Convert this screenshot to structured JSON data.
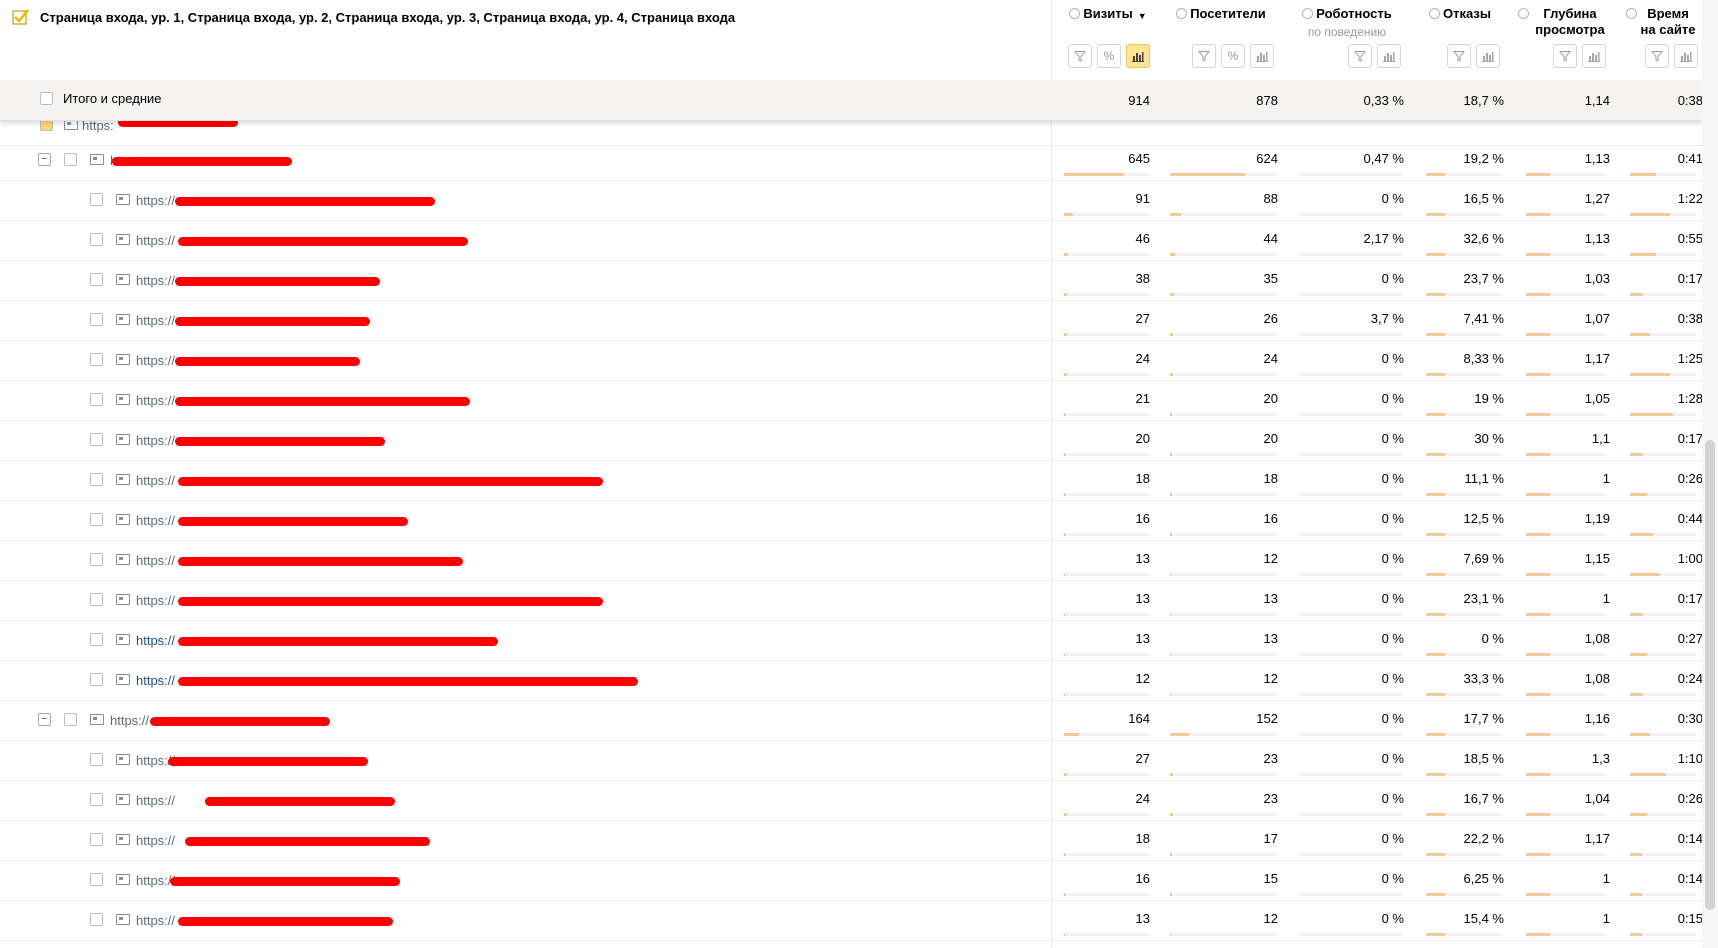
{
  "header": {
    "dimensions_title": "Страница входа, ур. 1, Страница входа, ур. 2, Страница входа, ур. 3, Страница входа, ур. 4, Страница входа",
    "columns": [
      {
        "title": "Визиты",
        "sub": "",
        "sorted": true,
        "sort_arrow": "▼"
      },
      {
        "title": "Посетители",
        "sub": ""
      },
      {
        "title": "Роботность",
        "sub": "по поведению"
      },
      {
        "title": "Отказы",
        "sub": ""
      },
      {
        "title": "Глубина просмотра",
        "sub": ""
      },
      {
        "title": "Время на сайте",
        "sub": ""
      }
    ]
  },
  "totals": {
    "label": "Итого и средние",
    "values": [
      "914",
      "878",
      "0,33 %",
      "18,7 %",
      "1,14",
      "0:38"
    ]
  },
  "partial_row": {
    "url": "https:"
  },
  "rows": [
    {
      "level": 1,
      "url": "ht",
      "toggle": "−",
      "link": false,
      "values": [
        "645",
        "624",
        "0,47 %",
        "19,2 %",
        "1,13",
        "0:41"
      ],
      "bars": [
        0.71,
        0.71,
        0.0,
        0.25,
        0.3,
        0.4
      ]
    },
    {
      "level": 2,
      "url": "https://",
      "link": false,
      "values": [
        "91",
        "88",
        "0 %",
        "16,5 %",
        "1,27",
        "1:22"
      ],
      "bars": [
        0.1,
        0.1,
        0.0,
        0.25,
        0.3,
        0.6
      ]
    },
    {
      "level": 2,
      "url": "https://",
      "link": false,
      "values": [
        "46",
        "44",
        "2,17 %",
        "32,6 %",
        "1,13",
        "0:55"
      ],
      "bars": [
        0.05,
        0.05,
        0.0,
        0.25,
        0.3,
        0.4
      ]
    },
    {
      "level": 2,
      "url": "https://",
      "link": false,
      "values": [
        "38",
        "35",
        "0 %",
        "23,7 %",
        "1,03",
        "0:17"
      ],
      "bars": [
        0.04,
        0.04,
        0.0,
        0.25,
        0.3,
        0.2
      ]
    },
    {
      "level": 2,
      "url": "https://",
      "link": false,
      "values": [
        "27",
        "26",
        "3,7 %",
        "7,41 %",
        "1,07",
        "0:38"
      ],
      "bars": [
        0.03,
        0.03,
        0.0,
        0.25,
        0.3,
        0.3
      ]
    },
    {
      "level": 2,
      "url": "https://",
      "link": false,
      "values": [
        "24",
        "24",
        "0 %",
        "8,33 %",
        "1,17",
        "1:25"
      ],
      "bars": [
        0.03,
        0.03,
        0.0,
        0.25,
        0.3,
        0.6
      ]
    },
    {
      "level": 2,
      "url": "https://",
      "link": false,
      "values": [
        "21",
        "20",
        "0 %",
        "19 %",
        "1,05",
        "1:28"
      ],
      "bars": [
        0.02,
        0.02,
        0.0,
        0.25,
        0.3,
        0.65
      ]
    },
    {
      "level": 2,
      "url": "https://",
      "link": false,
      "values": [
        "20",
        "20",
        "0 %",
        "30 %",
        "1,1",
        "0:17"
      ],
      "bars": [
        0.02,
        0.02,
        0.0,
        0.25,
        0.3,
        0.2
      ]
    },
    {
      "level": 2,
      "url": "https://",
      "link": false,
      "values": [
        "18",
        "18",
        "0 %",
        "11,1 %",
        "1",
        "0:26"
      ],
      "bars": [
        0.02,
        0.02,
        0.0,
        0.25,
        0.3,
        0.25
      ]
    },
    {
      "level": 2,
      "url": "https://",
      "link": false,
      "values": [
        "16",
        "16",
        "0 %",
        "12,5 %",
        "1,19",
        "0:44"
      ],
      "bars": [
        0.02,
        0.02,
        0.0,
        0.25,
        0.3,
        0.35
      ]
    },
    {
      "level": 2,
      "url": "https://",
      "link": false,
      "values": [
        "13",
        "12",
        "0 %",
        "7,69 %",
        "1,15",
        "1:00"
      ],
      "bars": [
        0.01,
        0.01,
        0.0,
        0.25,
        0.3,
        0.45
      ]
    },
    {
      "level": 2,
      "url": "https://",
      "link": false,
      "values": [
        "13",
        "13",
        "0 %",
        "23,1 %",
        "1",
        "0:17"
      ],
      "bars": [
        0.01,
        0.01,
        0.0,
        0.25,
        0.3,
        0.2
      ]
    },
    {
      "level": 2,
      "url": "https://",
      "link": true,
      "values": [
        "13",
        "13",
        "0 %",
        "0 %",
        "1,08",
        "0:27"
      ],
      "bars": [
        0.01,
        0.01,
        0.0,
        0.25,
        0.3,
        0.25
      ]
    },
    {
      "level": 2,
      "url": "https://",
      "link": true,
      "values": [
        "12",
        "12",
        "0 %",
        "33,3 %",
        "1,08",
        "0:24"
      ],
      "bars": [
        0.01,
        0.01,
        0.0,
        0.25,
        0.3,
        0.2
      ]
    },
    {
      "level": 1,
      "url": "https://",
      "toggle": "−",
      "link": false,
      "values": [
        "164",
        "152",
        "0 %",
        "17,7 %",
        "1,16",
        "0:30"
      ],
      "bars": [
        0.18,
        0.18,
        0.0,
        0.25,
        0.3,
        0.3
      ]
    },
    {
      "level": 2,
      "url": "https://",
      "link": false,
      "values": [
        "27",
        "23",
        "0 %",
        "18,5 %",
        "1,3",
        "1:10"
      ],
      "bars": [
        0.03,
        0.03,
        0.0,
        0.25,
        0.3,
        0.55
      ]
    },
    {
      "level": 2,
      "url": "https://",
      "link": false,
      "values": [
        "24",
        "23",
        "0 %",
        "16,7 %",
        "1,04",
        "0:26"
      ],
      "bars": [
        0.03,
        0.03,
        0.0,
        0.25,
        0.3,
        0.25
      ]
    },
    {
      "level": 2,
      "url": "https://",
      "link": false,
      "values": [
        "18",
        "17",
        "0 %",
        "22,2 %",
        "1,17",
        "0:14"
      ],
      "bars": [
        0.02,
        0.02,
        0.0,
        0.25,
        0.3,
        0.18
      ]
    },
    {
      "level": 2,
      "url": "https://",
      "link": false,
      "values": [
        "16",
        "15",
        "0 %",
        "6,25 %",
        "1",
        "0:14"
      ],
      "bars": [
        0.02,
        0.02,
        0.0,
        0.25,
        0.3,
        0.18
      ]
    },
    {
      "level": 2,
      "url": "https://",
      "link": false,
      "values": [
        "13",
        "12",
        "0 %",
        "15,4 %",
        "1",
        "0:15"
      ],
      "bars": [
        0.01,
        0.01,
        0.0,
        0.25,
        0.3,
        0.18
      ]
    }
  ],
  "colors": {
    "bar": "#f3c89a",
    "redaction": "#ff0000",
    "active_button": "#fde591"
  }
}
